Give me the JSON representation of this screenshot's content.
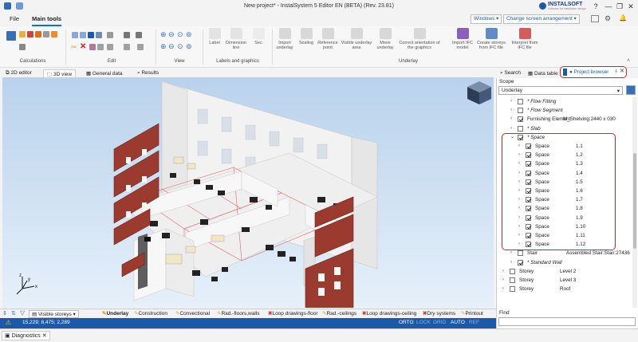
{
  "window": {
    "title": "New project* - InstalSystem 5 Editor EN (BETA) (Rev. 23.81)",
    "brand": "INSTALSOFT",
    "brand_sub": "Software for installation design",
    "controls": [
      "?",
      "—",
      "❐",
      "✕"
    ]
  },
  "menu": {
    "file": "File",
    "main_tools": "Main tools",
    "windows": "Windows",
    "change_arrangement": "Change screen arrangement"
  },
  "ribbon": {
    "groups": [
      "Calculations",
      "Edit",
      "View",
      "Labels and graphics",
      "Underlay"
    ],
    "labels_buttons": [
      {
        "label": "Label"
      },
      {
        "label": "Dimension line"
      },
      {
        "label": "Sec"
      }
    ],
    "underlay_buttons": [
      {
        "label": "Import underlay"
      },
      {
        "label": "Scaling"
      },
      {
        "label": "Reference point"
      },
      {
        "label": "Visible underlay area"
      },
      {
        "label": "Move underlay"
      },
      {
        "label": "Correct orientation of the graphics"
      },
      {
        "label": "Import IFC model"
      },
      {
        "label": "Create storeys from IFC file"
      },
      {
        "label": "Interpret from IFC file"
      }
    ]
  },
  "view_tabs": [
    {
      "label": "2D editor"
    },
    {
      "label": "3D view"
    },
    {
      "label": "General data"
    },
    {
      "label": "Results"
    }
  ],
  "right_tabs": {
    "search": "Search",
    "data_table": "Data table",
    "project_browser": "Project browser"
  },
  "panel": {
    "scope_label": "Scope",
    "scope_value": "Underlay",
    "find_label": "Find",
    "tree": [
      {
        "name": "* Flow Fitting",
        "value": "",
        "indent": 1,
        "checked": false,
        "italic": true
      },
      {
        "name": "* Flow Segment",
        "value": "",
        "indent": 1,
        "checked": false,
        "italic": true
      },
      {
        "name": "Furnishing Element",
        "value": "M_Shelving:2440 x 030",
        "indent": 1,
        "checked": true,
        "italic": false
      },
      {
        "name": "* Slab",
        "value": "",
        "indent": 1,
        "checked": false,
        "italic": true
      },
      {
        "name": "* Space",
        "value": "",
        "indent": 1,
        "checked": true,
        "italic": true
      },
      {
        "name": "Space",
        "value": "1.1",
        "indent": 2,
        "checked": true,
        "italic": false
      },
      {
        "name": "Space",
        "value": "1.2",
        "indent": 2,
        "checked": true,
        "italic": false
      },
      {
        "name": "Space",
        "value": "1.3",
        "indent": 2,
        "checked": true,
        "italic": false
      },
      {
        "name": "Space",
        "value": "1.4",
        "indent": 2,
        "checked": true,
        "italic": false
      },
      {
        "name": "Space",
        "value": "1.5",
        "indent": 2,
        "checked": true,
        "italic": false
      },
      {
        "name": "Space",
        "value": "1.6",
        "indent": 2,
        "checked": true,
        "italic": false
      },
      {
        "name": "Space",
        "value": "1.7",
        "indent": 2,
        "checked": true,
        "italic": false
      },
      {
        "name": "Space",
        "value": "1.8",
        "indent": 2,
        "checked": true,
        "italic": false
      },
      {
        "name": "Space",
        "value": "1.9",
        "indent": 2,
        "checked": true,
        "italic": false
      },
      {
        "name": "Space",
        "value": "1.10",
        "indent": 2,
        "checked": true,
        "italic": false
      },
      {
        "name": "Space",
        "value": "1.11",
        "indent": 2,
        "checked": true,
        "italic": false
      },
      {
        "name": "Space",
        "value": "1.12",
        "indent": 2,
        "checked": true,
        "italic": false
      },
      {
        "name": "Stair",
        "value": "Assembled Stair:Stair:27436",
        "indent": 1,
        "checked": false,
        "italic": false
      },
      {
        "name": "* Standard Wall",
        "value": "",
        "indent": 1,
        "checked": true,
        "italic": true
      },
      {
        "name": "Storey",
        "value": "Level 2",
        "indent": 0,
        "checked": false,
        "italic": false
      },
      {
        "name": "Storey",
        "value": "Level 3",
        "indent": 0,
        "checked": false,
        "italic": false
      },
      {
        "name": "Storey",
        "value": "Roof",
        "indent": 0,
        "checked": false,
        "italic": false
      }
    ]
  },
  "bottom": {
    "visible_storeys": "Visible storeys",
    "tabs": [
      {
        "label": "Underlay",
        "icon": "pencil",
        "bold": true
      },
      {
        "label": "Construction",
        "icon": "pencil",
        "bold": false
      },
      {
        "label": "Convectional",
        "icon": "pencil",
        "bold": false
      },
      {
        "label": "Rad.-floors,walls",
        "icon": "pencil",
        "bold": false
      },
      {
        "label": "Loop drawings-floor",
        "icon": "cross",
        "bold": false
      },
      {
        "label": "Rad.-ceilings",
        "icon": "pencil",
        "bold": false
      },
      {
        "label": "Loop drawings-ceiling",
        "icon": "cross",
        "bold": false
      },
      {
        "label": "Dry systems",
        "icon": "cross",
        "bold": false
      },
      {
        "label": "Printout",
        "icon": "pencil",
        "bold": false
      }
    ]
  },
  "status": {
    "coords": "15,229; 8,475; 2,289",
    "modes": [
      "ORTO",
      "LOCK",
      "GRID",
      "AUTO",
      "REF"
    ]
  },
  "diagnostics": {
    "label": "Diagnostics"
  },
  "colors": {
    "accent": "#1a5aa8",
    "highlight": "#d81f26",
    "brick": "#9b3a2e"
  }
}
